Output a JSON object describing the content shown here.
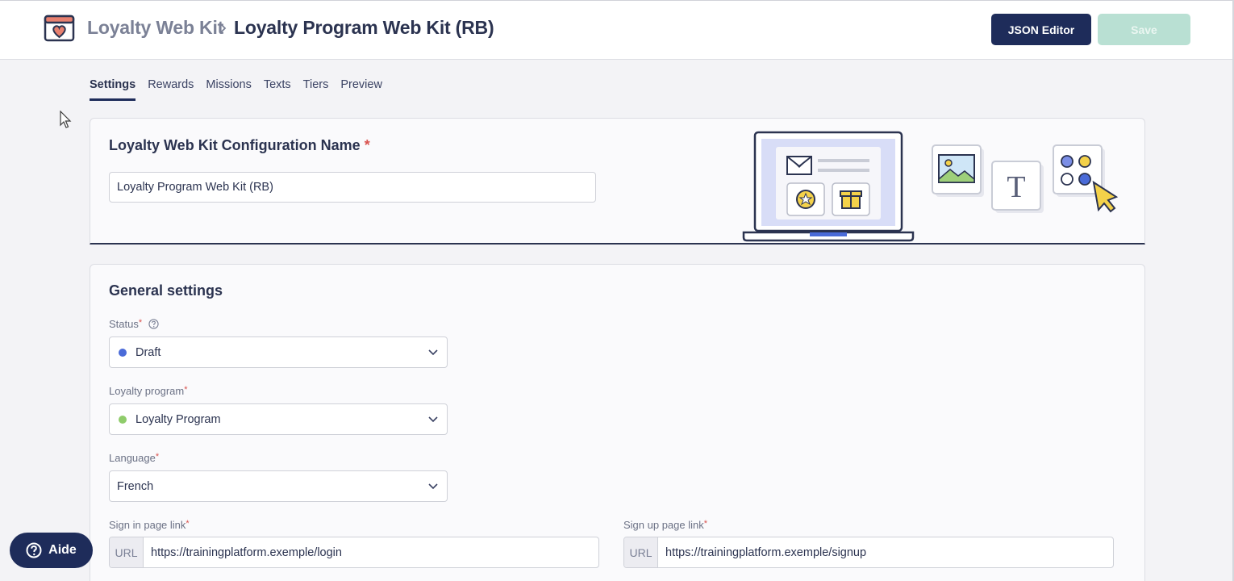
{
  "header": {
    "breadcrumb_parent": "Loyalty Web Kit",
    "breadcrumb_current": "Loyalty Program Web Kit (RB)",
    "json_editor_label": "JSON Editor",
    "save_label": "Save"
  },
  "tabs": [
    {
      "label": "Settings",
      "active": true
    },
    {
      "label": "Rewards"
    },
    {
      "label": "Missions"
    },
    {
      "label": "Texts"
    },
    {
      "label": "Tiers"
    },
    {
      "label": "Preview"
    }
  ],
  "config_card": {
    "title": "Loyalty Web Kit Configuration Name",
    "required_mark": "*",
    "name_value": "Loyalty Program Web Kit (RB)"
  },
  "general": {
    "title": "General settings",
    "status": {
      "label": "Status",
      "required": "*",
      "value": "Draft",
      "dot_color": "#4a6bd8"
    },
    "loyalty_program": {
      "label": "Loyalty program",
      "required": "*",
      "value": "Loyalty Program",
      "dot_color": "#8fcc6b"
    },
    "language": {
      "label": "Language",
      "required": "*",
      "value": "French"
    },
    "sign_in": {
      "label": "Sign in page link",
      "required": "*",
      "prefix": "URL",
      "value": "https://trainingplatform.exemple/login"
    },
    "sign_up": {
      "label": "Sign up page link",
      "required": "*",
      "prefix": "URL",
      "value": "https://trainingplatform.exemple/signup"
    }
  },
  "help_button": {
    "label": "Aide"
  },
  "colors": {
    "primary": "#1e2c5a",
    "save_disabled": "#b9e0d3",
    "required": "#d9534f"
  },
  "illustration": {
    "text_glyph": "T"
  }
}
